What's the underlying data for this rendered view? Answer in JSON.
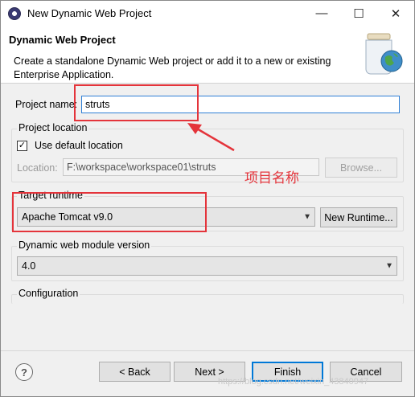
{
  "window": {
    "title": "New Dynamic Web Project",
    "minimize_glyph": "—",
    "maximize_glyph": "☐",
    "close_glyph": "✕"
  },
  "header": {
    "title": "Dynamic Web Project",
    "description": "Create a standalone Dynamic Web project or add it to a new or existing Enterprise Application."
  },
  "form": {
    "project_name_label": "Project name:",
    "project_name_value": "struts",
    "project_location_title": "Project location",
    "use_default_label": "Use default location",
    "use_default_checked": true,
    "location_label": "Location:",
    "location_value": "F:\\workspace\\workspace01\\struts",
    "browse_label": "Browse...",
    "target_runtime_title": "Target runtime",
    "target_runtime_value": "Apache Tomcat v9.0",
    "new_runtime_label": "New Runtime...",
    "module_version_title": "Dynamic web module version",
    "module_version_value": "4.0",
    "configuration_title": "Configuration"
  },
  "annotation": {
    "text": "项目名称",
    "color": "#e4343b"
  },
  "buttons": {
    "help_glyph": "?",
    "back_label": "< Back",
    "next_label": "Next >",
    "finish_label": "Finish",
    "cancel_label": "Cancel"
  },
  "watermark": "https://blog.csdn.net/weixin_43840947"
}
